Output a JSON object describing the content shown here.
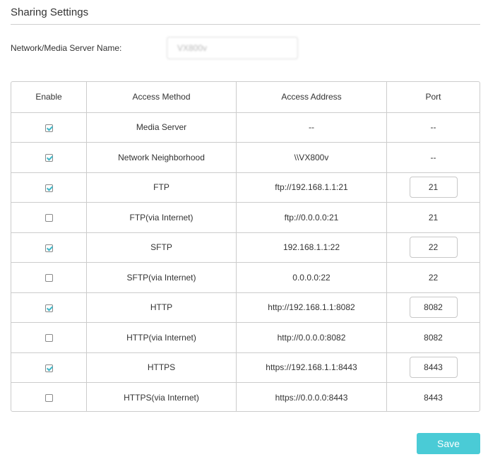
{
  "section_title": "Sharing Settings",
  "server_name": {
    "label": "Network/Media Server Name:",
    "value": "VX800v"
  },
  "table": {
    "headers": [
      "Enable",
      "Access Method",
      "Access Address",
      "Port"
    ],
    "rows": [
      {
        "enabled": true,
        "method": "Media Server",
        "address": "--",
        "port": "--",
        "port_editable": false
      },
      {
        "enabled": true,
        "method": "Network Neighborhood",
        "address": "\\\\VX800v",
        "port": "--",
        "port_editable": false
      },
      {
        "enabled": true,
        "method": "FTP",
        "address": "ftp://192.168.1.1:21",
        "port": "21",
        "port_editable": true
      },
      {
        "enabled": false,
        "method": "FTP(via Internet)",
        "address": "ftp://0.0.0.0:21",
        "port": "21",
        "port_editable": false
      },
      {
        "enabled": true,
        "method": "SFTP",
        "address": "192.168.1.1:22",
        "port": "22",
        "port_editable": true
      },
      {
        "enabled": false,
        "method": "SFTP(via Internet)",
        "address": "0.0.0.0:22",
        "port": "22",
        "port_editable": false
      },
      {
        "enabled": true,
        "method": "HTTP",
        "address": "http://192.168.1.1:8082",
        "port": "8082",
        "port_editable": true
      },
      {
        "enabled": false,
        "method": "HTTP(via Internet)",
        "address": "http://0.0.0.0:8082",
        "port": "8082",
        "port_editable": false
      },
      {
        "enabled": true,
        "method": "HTTPS",
        "address": "https://192.168.1.1:8443",
        "port": "8443",
        "port_editable": true
      },
      {
        "enabled": false,
        "method": "HTTPS(via Internet)",
        "address": "https://0.0.0.0:8443",
        "port": "8443",
        "port_editable": false
      }
    ]
  },
  "save_label": "Save",
  "colors": {
    "accent": "#4acbd6",
    "check": "#3fb6c6",
    "border": "#cccccc",
    "text": "#333333"
  }
}
